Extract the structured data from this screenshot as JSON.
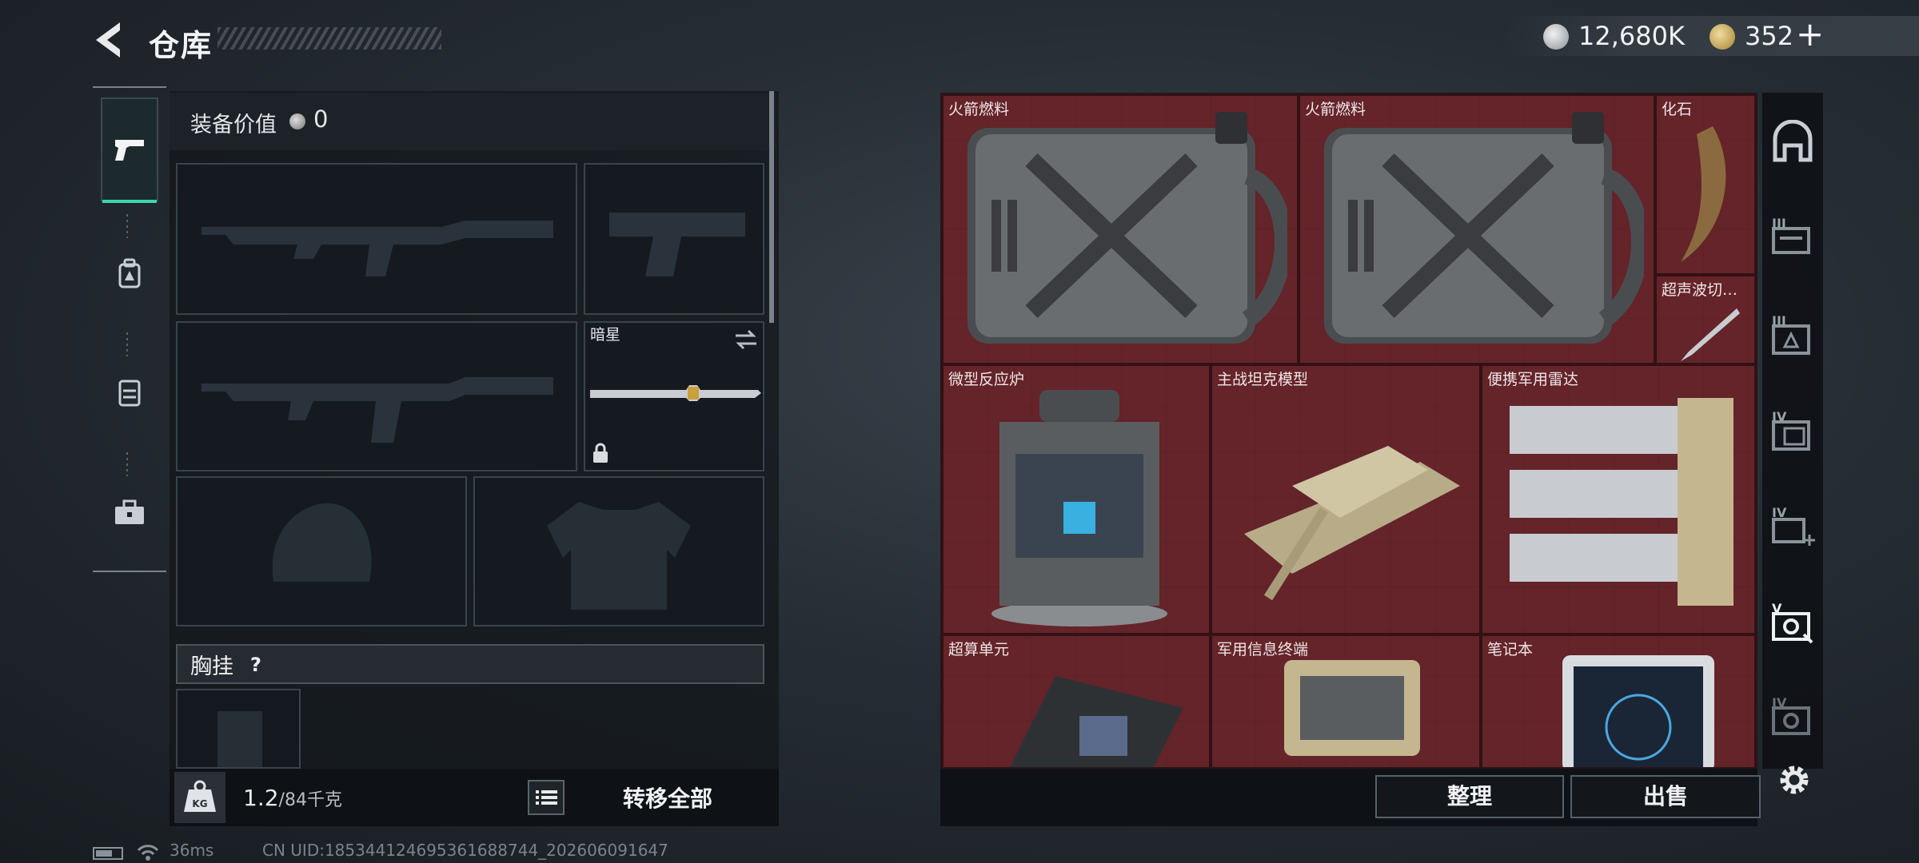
{
  "header": {
    "title": "仓库"
  },
  "currency": {
    "coins_value": "12,680K",
    "premium_value": "352",
    "add_symbol": "+"
  },
  "tabs": [
    {
      "name": "weapons",
      "icon": "pistol-icon",
      "active": true
    },
    {
      "name": "backpack",
      "icon": "backpack-icon"
    },
    {
      "name": "vest",
      "icon": "vest-icon"
    },
    {
      "name": "case",
      "icon": "toolbox-icon"
    }
  ],
  "loadout": {
    "equip_label": "装备价值",
    "equip_value": "0",
    "melee_name": "暗星",
    "chest_label": "胸挂",
    "chest_help": "?",
    "weight_current": "1.2",
    "weight_max": "/84千克",
    "transfer_label": "转移全部"
  },
  "storage": {
    "items": [
      {
        "label": "火箭燃料",
        "icon": "fuel-can-icon"
      },
      {
        "label": "火箭燃料",
        "icon": "fuel-can-icon"
      },
      {
        "label": "化石",
        "icon": "claw-fossil-icon"
      },
      {
        "label": "超声波切…",
        "icon": "ultrasonic-cutter-icon"
      },
      {
        "label": "微型反应炉",
        "icon": "reactor-icon"
      },
      {
        "label": "主战坦克模型",
        "icon": "tank-model-icon"
      },
      {
        "label": "便携军用雷达",
        "icon": "radar-icon"
      },
      {
        "label": "超算单元",
        "icon": "compute-unit-icon"
      },
      {
        "label": "军用信息终端",
        "icon": "terminal-icon"
      },
      {
        "label": "笔记本",
        "icon": "laptop-icon"
      }
    ],
    "sort_label": "整理",
    "sell_label": "出售"
  },
  "sidebar": {
    "roman": [
      "III",
      "III",
      "IV",
      "IV",
      "V",
      "IV"
    ]
  },
  "footer": {
    "ping": "36ms",
    "uid": "CN UID:18534412469536168874​4_202606091647"
  },
  "colors": {
    "accent": "#3ad6b0",
    "storage_bg": "#5a2328"
  }
}
